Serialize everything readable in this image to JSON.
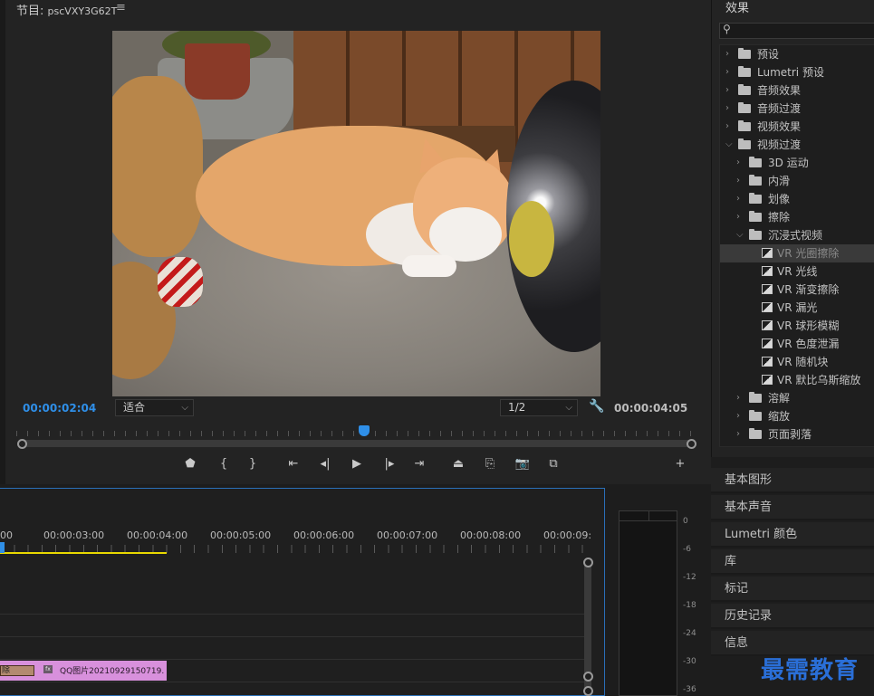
{
  "program": {
    "title_prefix": "节目:",
    "sequence_name": "pscVXY3G62T",
    "menu_icon": "hamburger-icon",
    "current_timecode": "00:00:02:04",
    "duration_timecode": "00:00:04:05",
    "fit_value": "适合",
    "resolution_value": "1/2",
    "playhead_progress": 0.52
  },
  "effects": {
    "title": "效果",
    "tree": [
      {
        "label": "预设",
        "type": "preset-folder",
        "depth": 0,
        "expanded": false
      },
      {
        "label": "Lumetri 预设",
        "type": "preset-folder",
        "depth": 0,
        "expanded": false
      },
      {
        "label": "音频效果",
        "type": "folder",
        "depth": 0,
        "expanded": false
      },
      {
        "label": "音频过渡",
        "type": "folder",
        "depth": 0,
        "expanded": false
      },
      {
        "label": "视频效果",
        "type": "folder",
        "depth": 0,
        "expanded": false
      },
      {
        "label": "视频过渡",
        "type": "folder",
        "depth": 0,
        "expanded": true
      },
      {
        "label": "3D 运动",
        "type": "folder",
        "depth": 1,
        "expanded": false
      },
      {
        "label": "内滑",
        "type": "folder",
        "depth": 1,
        "expanded": false
      },
      {
        "label": "划像",
        "type": "folder",
        "depth": 1,
        "expanded": false
      },
      {
        "label": "擦除",
        "type": "folder",
        "depth": 1,
        "expanded": false
      },
      {
        "label": "沉浸式视频",
        "type": "folder",
        "depth": 1,
        "expanded": true
      },
      {
        "label": "VR 光圈擦除",
        "type": "effect",
        "depth": 2,
        "selected": true
      },
      {
        "label": "VR 光线",
        "type": "effect",
        "depth": 2
      },
      {
        "label": "VR 渐变擦除",
        "type": "effect",
        "depth": 2
      },
      {
        "label": "VR 漏光",
        "type": "effect",
        "depth": 2
      },
      {
        "label": "VR 球形模糊",
        "type": "effect",
        "depth": 2
      },
      {
        "label": "VR 色度泄漏",
        "type": "effect",
        "depth": 2
      },
      {
        "label": "VR 随机块",
        "type": "effect",
        "depth": 2
      },
      {
        "label": "VR 默比乌斯缩放",
        "type": "effect",
        "depth": 2
      },
      {
        "label": "溶解",
        "type": "folder",
        "depth": 1,
        "expanded": false
      },
      {
        "label": "缩放",
        "type": "folder",
        "depth": 1,
        "expanded": false
      },
      {
        "label": "页面剥落",
        "type": "folder",
        "depth": 1,
        "expanded": false
      }
    ]
  },
  "side_panels": [
    "基本图形",
    "基本声音",
    "Lumetri 颜色",
    "库",
    "标记",
    "历史记录",
    "信息"
  ],
  "timeline": {
    "timecodes": [
      "00",
      "00:00:03:00",
      "00:00:04:00",
      "00:00:05:00",
      "00:00:06:00",
      "00:00:07:00",
      "00:00:08:00",
      "00:00:09:"
    ],
    "clip_thumb_label": "除",
    "clip_fx_badge": "fx",
    "clip_label": "QQ图片20210929150719."
  },
  "meter": {
    "db_labels": [
      "0",
      "-6",
      "-12",
      "-18",
      "-24",
      "-30",
      "-36"
    ]
  },
  "watermark": "最需教育",
  "colors": {
    "accent_blue": "#2f8fe8",
    "work_area_yellow": "#e8d800",
    "clip_pink": "#d890dc",
    "panel_bg": "#232323",
    "watermark": "#2a6fd8"
  }
}
